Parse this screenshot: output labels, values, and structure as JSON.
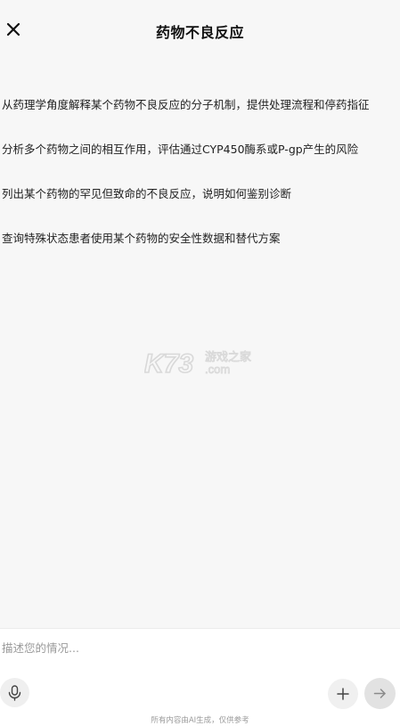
{
  "header": {
    "title": "药物不良反应"
  },
  "suggestions": [
    {
      "text": "从药理学角度解释某个药物不良反应的分子机制，提供处理流程和停药指征"
    },
    {
      "text": "分析多个药物之间的相互作用，评估通过CYP450酶系或P-gp产生的风险"
    },
    {
      "text": "列出某个药物的罕见但致命的不良反应，说明如何鉴别诊断"
    },
    {
      "text": "查询特殊状态患者使用某个药物的安全性数据和替代方案"
    }
  ],
  "watermark": {
    "logo_text": "K73",
    "cn_text": "游戏之家",
    "domain_text": ".com"
  },
  "composer": {
    "placeholder": "描述您的情况...",
    "value": "",
    "disclaimer": "所有内容由AI生成，仅供参考"
  },
  "icons": {
    "close": "close-icon",
    "mic": "microphone-icon",
    "plus": "plus-icon",
    "send": "arrow-right-icon"
  },
  "colors": {
    "background": "#f7f7f7",
    "composer_bg": "#ffffff",
    "send_button": "#e2e2e2",
    "muted_text": "#9a9a9a"
  }
}
